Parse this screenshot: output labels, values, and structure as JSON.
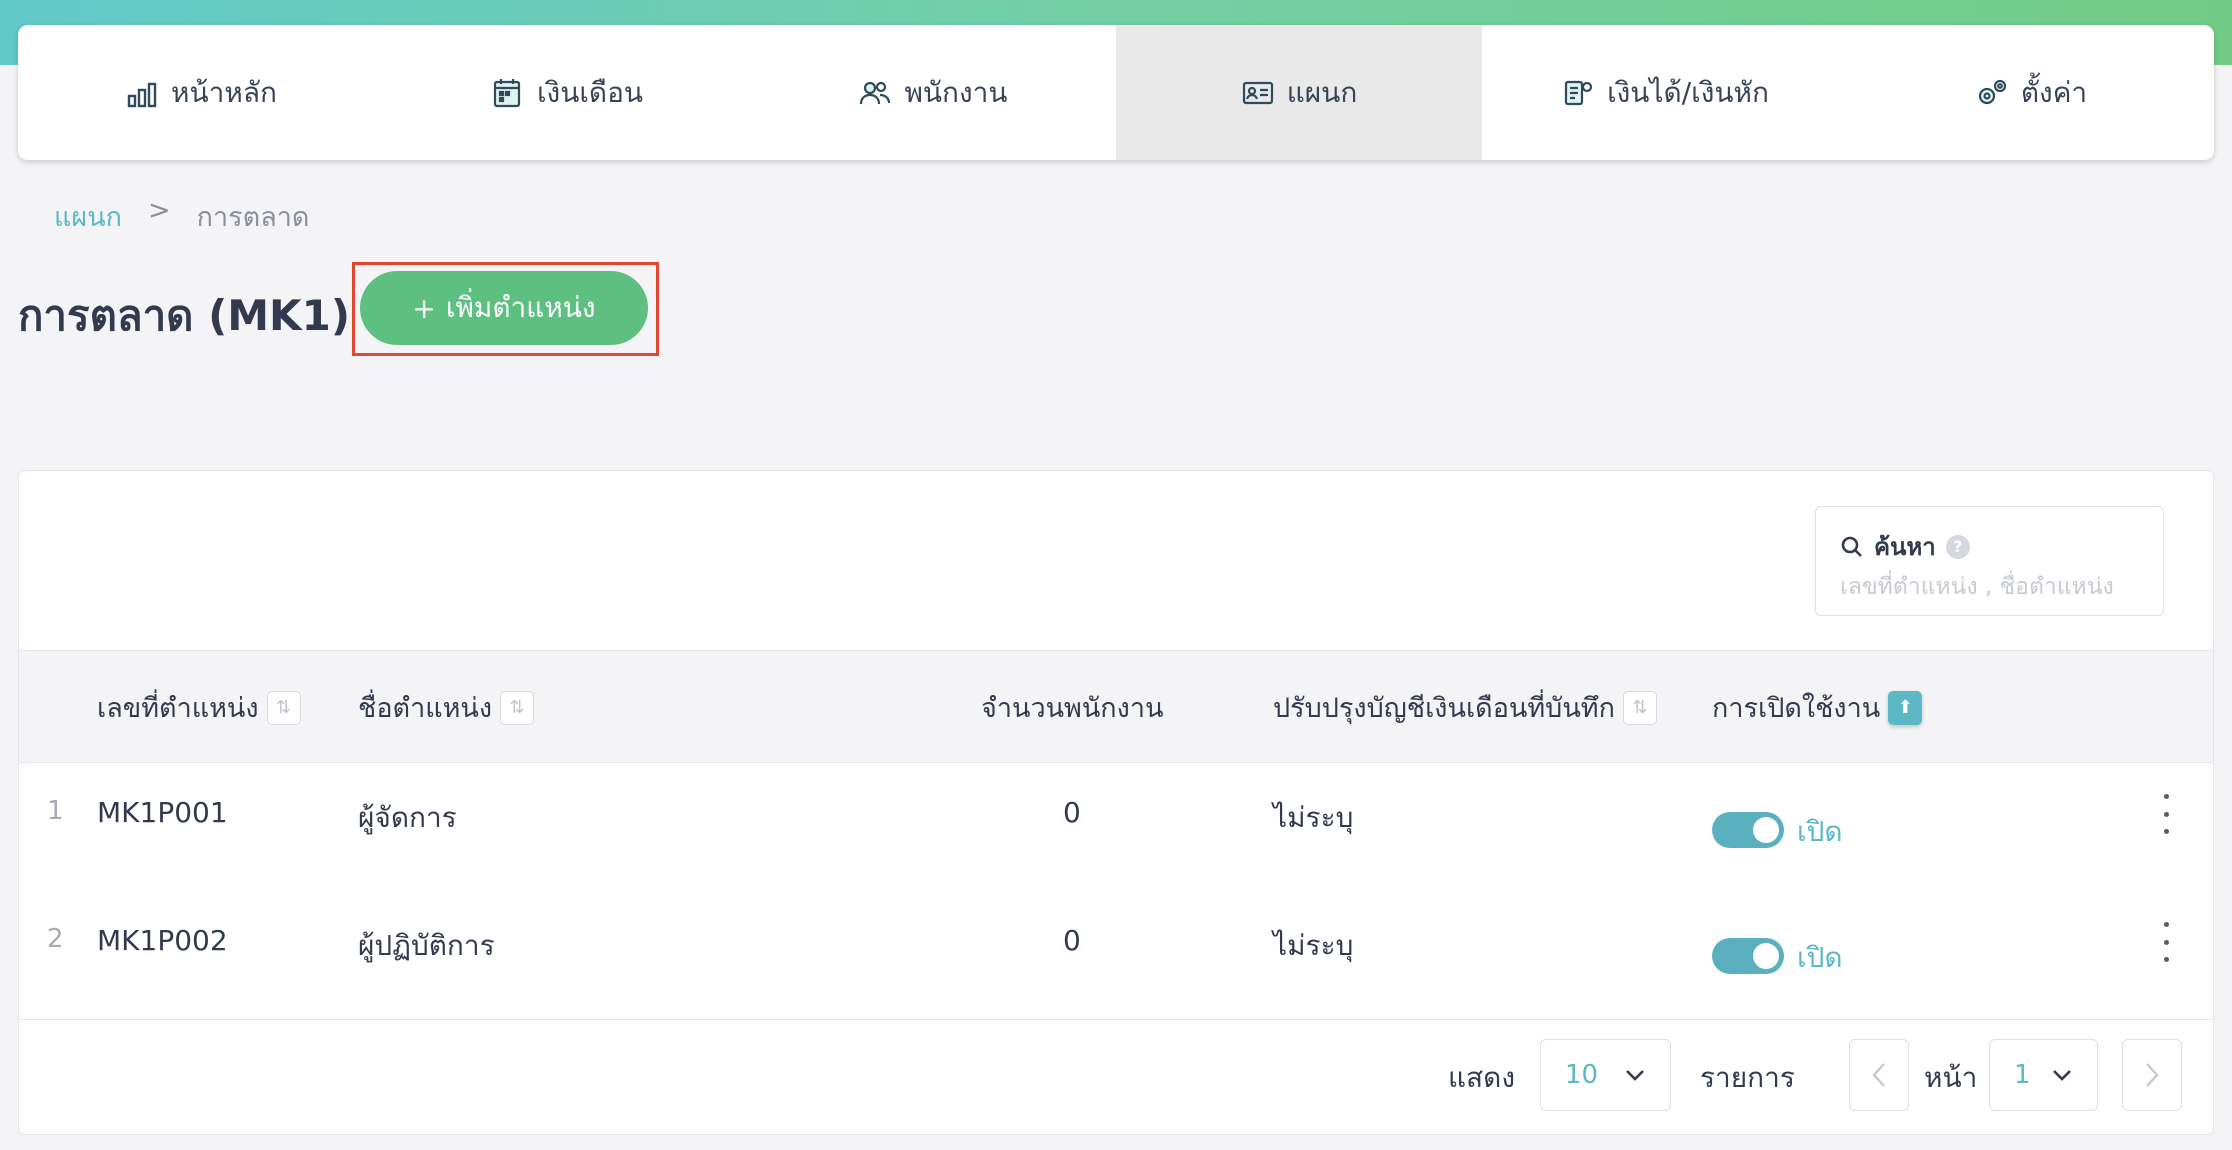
{
  "nav": {
    "items": [
      {
        "label": "หน้าหลัก",
        "icon": "bar-chart-icon",
        "active": false
      },
      {
        "label": "เงินเดือน",
        "icon": "calendar-icon",
        "active": false
      },
      {
        "label": "พนักงาน",
        "icon": "users-icon",
        "active": false
      },
      {
        "label": "แผนก",
        "icon": "id-card-icon",
        "active": true
      },
      {
        "label": "เงินได้/เงินหัก",
        "icon": "money-icon",
        "active": false
      },
      {
        "label": "ตั้งค่า",
        "icon": "gear-icon",
        "active": false
      }
    ]
  },
  "breadcrumb": {
    "parent": "แผนก",
    "separator": ">",
    "current": "การตลาด"
  },
  "page": {
    "title": "การตลาด (MK1)",
    "add_button": "เพิ่มตำแหน่ง",
    "add_icon": "+"
  },
  "search": {
    "label": "ค้นหา",
    "help": "?",
    "placeholder": "เลขที่ตำแหน่ง , ชื่อตำแหน่ง"
  },
  "table": {
    "headers": {
      "code": "เลขที่ตำแหน่ง",
      "name": "ชื่อตำแหน่ง",
      "count": "จำนวนพนักงาน",
      "payroll": "ปรับปรุงบัญชีเงินเดือนที่บันทึก",
      "enabled": "การเปิดใช้งาน"
    },
    "rows": [
      {
        "index": "1",
        "code": "MK1P001",
        "name": "ผู้จัดการ",
        "count": "0",
        "payroll": "ไม่ระบุ",
        "status": "เปิด"
      },
      {
        "index": "2",
        "code": "MK1P002",
        "name": "ผู้ปฏิบัติการ",
        "count": "0",
        "payroll": "ไม่ระบุ",
        "status": "เปิด"
      }
    ]
  },
  "pagination": {
    "show_label": "แสดง",
    "page_size": "10",
    "items_label": "รายการ",
    "page_label": "หน้า",
    "page": "1"
  },
  "colors": {
    "accent": "#5bb8c4",
    "primary_button": "#5dbf80",
    "highlight": "#e0472f"
  }
}
